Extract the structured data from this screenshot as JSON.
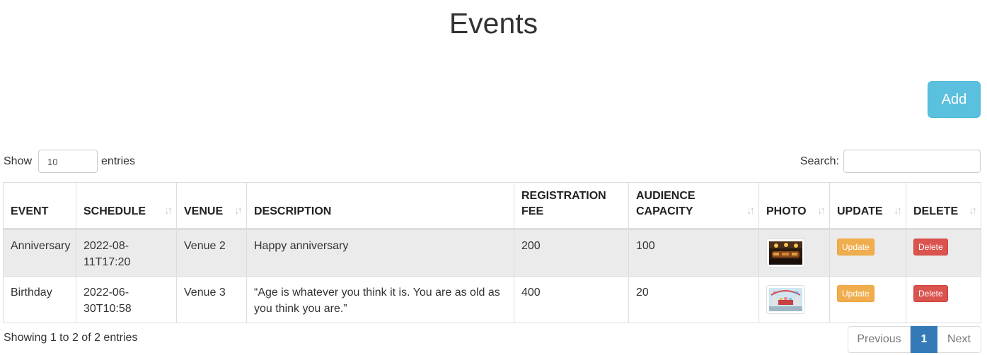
{
  "page": {
    "title": "Events"
  },
  "toolbar": {
    "add_label": "Add"
  },
  "length": {
    "show_label": "Show",
    "value": "10",
    "entries_label": "entries"
  },
  "search": {
    "label": "Search:",
    "value": ""
  },
  "table": {
    "columns": [
      {
        "label": "EVENT",
        "sortable": false
      },
      {
        "label": "SCHEDULE",
        "sortable": true
      },
      {
        "label": "VENUE",
        "sortable": true
      },
      {
        "label": "DESCRIPTION",
        "sortable": false
      },
      {
        "label": "REGISTRATION FEE",
        "sortable": false
      },
      {
        "label": "AUDIENCE CAPACITY",
        "sortable": true
      },
      {
        "label": "PHOTO",
        "sortable": true
      },
      {
        "label": "UPDATE",
        "sortable": true
      },
      {
        "label": "DELETE",
        "sortable": true
      }
    ],
    "rows": [
      {
        "event": "Anniversary",
        "schedule": "2022-08-11T17:20",
        "venue": "Venue 2",
        "description": "Happy anniversary",
        "fee": "200",
        "capacity": "100",
        "photo": "banquet-hall-photo",
        "update_label": "Update",
        "delete_label": "Delete"
      },
      {
        "event": "Birthday",
        "schedule": "2022-06-30T10:58",
        "venue": "Venue 3",
        "description": "“Age is whatever you think it is. You are as old as you think you are.”",
        "fee": "400",
        "capacity": "20",
        "photo": "party-room-photo",
        "update_label": "Update",
        "delete_label": "Delete"
      }
    ]
  },
  "footer": {
    "info": "Showing 1 to 2 of 2 entries",
    "pagination": {
      "previous": "Previous",
      "current": "1",
      "next": "Next"
    }
  },
  "colors": {
    "add_button": "#5bc0de",
    "update_button": "#f0ad4e",
    "delete_button": "#d9534f",
    "active_page": "#337ab7",
    "odd_row": "#ebebeb"
  },
  "icons": {
    "sort": "sort-arrows-icon"
  }
}
